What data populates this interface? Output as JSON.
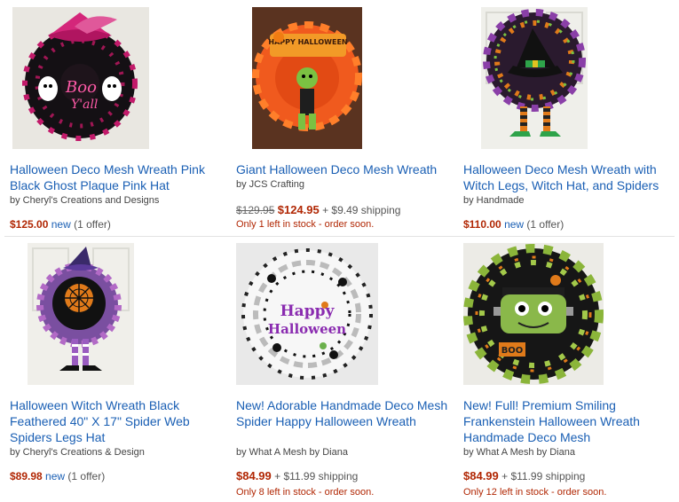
{
  "products": [
    {
      "title": "Halloween Deco Mesh Wreath Pink Black Ghost Plaque Pink Hat",
      "seller": "by Cheryl's Creations and Designs",
      "price": "$125.00",
      "new_label": "new",
      "offers": "(1 offer)"
    },
    {
      "title": "Giant Halloween Deco Mesh Wreath",
      "seller": "by JCS Crafting",
      "old_price": "$129.95",
      "price": "$124.95",
      "shipping": "+ $9.49 shipping",
      "stock": "Only 1 left in stock - order soon.",
      "sign_text": "HAPPY HALLOWEEN"
    },
    {
      "title": "Halloween Deco Mesh Wreath with Witch Legs, Witch Hat, and Spiders",
      "seller": "by Handmade",
      "price": "$110.00",
      "new_label": "new",
      "offers": "(1 offer)"
    },
    {
      "title": "Halloween Witch Wreath Black Feathered 40\" X 17\" Spider Web Spiders Legs Hat",
      "seller": "by Cheryl's Creations & Design",
      "price": "$89.98",
      "new_label": "new",
      "offers": "(1 offer)"
    },
    {
      "title": "New! Adorable Handmade Deco Mesh Spider Happy Halloween Wreath",
      "seller": "by What A Mesh by Diana",
      "price": "$84.99",
      "shipping": "+ $11.99 shipping",
      "stock": "Only 8 left in stock - order soon.",
      "sign_line1": "Happy",
      "sign_line2": "Halloween"
    },
    {
      "title": "New! Full! Premium Smiling Frankenstein Halloween Wreath Handmade Deco Mesh",
      "seller": "by What A Mesh by Diana",
      "price": "$84.99",
      "shipping": "+ $11.99 shipping",
      "stock": "Only 12 left in stock - order soon.",
      "sign_text": "BOO"
    }
  ],
  "colors": {
    "link": "#1a5fb4",
    "price": "#b12704"
  }
}
